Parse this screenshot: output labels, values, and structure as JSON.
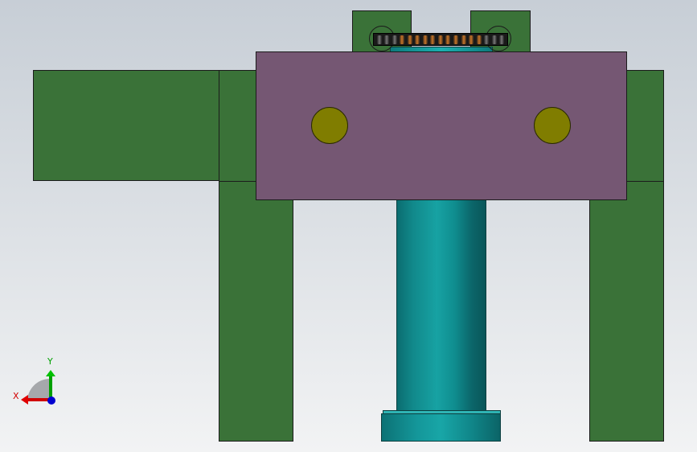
{
  "colors": {
    "background_top": "#c7ced6",
    "background_bottom": "#f2f3f4",
    "frame_green": "#3a7238",
    "block_purple": "#755773",
    "bolt_olive": "#807d00",
    "shaft_teal": "#139596",
    "axis_x": "#d10000",
    "axis_y": "#00a000",
    "axis_z": "#0000d0"
  },
  "triad": {
    "y_label": "Y",
    "x_label": "X",
    "icons": [
      "axis-triad-icon"
    ]
  },
  "parts": [
    "left-arm",
    "left-column",
    "right-column",
    "upper-brackets",
    "purple-block",
    "bolts",
    "bearing",
    "shaft"
  ]
}
